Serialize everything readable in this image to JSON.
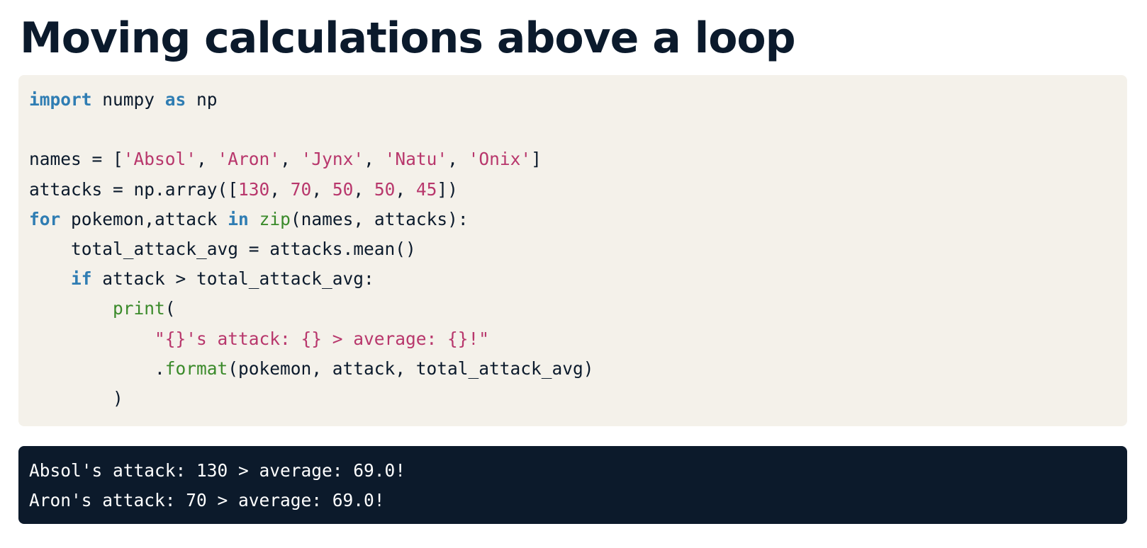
{
  "title": "Moving calculations above a loop",
  "colors": {
    "title": "#0b1a2c",
    "code_background": "#f4f1ea",
    "output_background": "#0c1a2b",
    "keyword": "#2f7db3",
    "string": "#b8376c",
    "number": "#b8376c",
    "builtin": "#3a8a2a",
    "plain": "#0b1a2c",
    "output_text": "#ffffff"
  },
  "code": {
    "language": "python",
    "lines": [
      [
        {
          "t": "kw",
          "v": "import"
        },
        {
          "t": "plain",
          "v": " numpy "
        },
        {
          "t": "kw",
          "v": "as"
        },
        {
          "t": "plain",
          "v": " np"
        }
      ],
      [],
      [
        {
          "t": "plain",
          "v": "names = ["
        },
        {
          "t": "str",
          "v": "'Absol'"
        },
        {
          "t": "plain",
          "v": ", "
        },
        {
          "t": "str",
          "v": "'Aron'"
        },
        {
          "t": "plain",
          "v": ", "
        },
        {
          "t": "str",
          "v": "'Jynx'"
        },
        {
          "t": "plain",
          "v": ", "
        },
        {
          "t": "str",
          "v": "'Natu'"
        },
        {
          "t": "plain",
          "v": ", "
        },
        {
          "t": "str",
          "v": "'Onix'"
        },
        {
          "t": "plain",
          "v": "]"
        }
      ],
      [
        {
          "t": "plain",
          "v": "attacks = np.array(["
        },
        {
          "t": "num",
          "v": "130"
        },
        {
          "t": "plain",
          "v": ", "
        },
        {
          "t": "num",
          "v": "70"
        },
        {
          "t": "plain",
          "v": ", "
        },
        {
          "t": "num",
          "v": "50"
        },
        {
          "t": "plain",
          "v": ", "
        },
        {
          "t": "num",
          "v": "50"
        },
        {
          "t": "plain",
          "v": ", "
        },
        {
          "t": "num",
          "v": "45"
        },
        {
          "t": "plain",
          "v": "])"
        }
      ],
      [
        {
          "t": "kw",
          "v": "for"
        },
        {
          "t": "plain",
          "v": " pokemon,attack "
        },
        {
          "t": "kw",
          "v": "in"
        },
        {
          "t": "plain",
          "v": " "
        },
        {
          "t": "fn",
          "v": "zip"
        },
        {
          "t": "plain",
          "v": "(names, attacks):"
        }
      ],
      [
        {
          "t": "plain",
          "v": "    total_attack_avg = attacks.mean()"
        }
      ],
      [
        {
          "t": "plain",
          "v": "    "
        },
        {
          "t": "kw",
          "v": "if"
        },
        {
          "t": "plain",
          "v": " attack > total_attack_avg:"
        }
      ],
      [
        {
          "t": "plain",
          "v": "        "
        },
        {
          "t": "fn",
          "v": "print"
        },
        {
          "t": "plain",
          "v": "("
        }
      ],
      [
        {
          "t": "plain",
          "v": "            "
        },
        {
          "t": "str",
          "v": "\"{}'s attack: {} > average: {}!\""
        }
      ],
      [
        {
          "t": "plain",
          "v": "            ."
        },
        {
          "t": "fn",
          "v": "format"
        },
        {
          "t": "plain",
          "v": "(pokemon, attack, total_attack_avg)"
        }
      ],
      [
        {
          "t": "plain",
          "v": "        )"
        }
      ]
    ]
  },
  "output": {
    "lines": [
      "Absol's attack: 130 > average: 69.0!",
      "Aron's attack: 70 > average: 69.0!"
    ]
  }
}
